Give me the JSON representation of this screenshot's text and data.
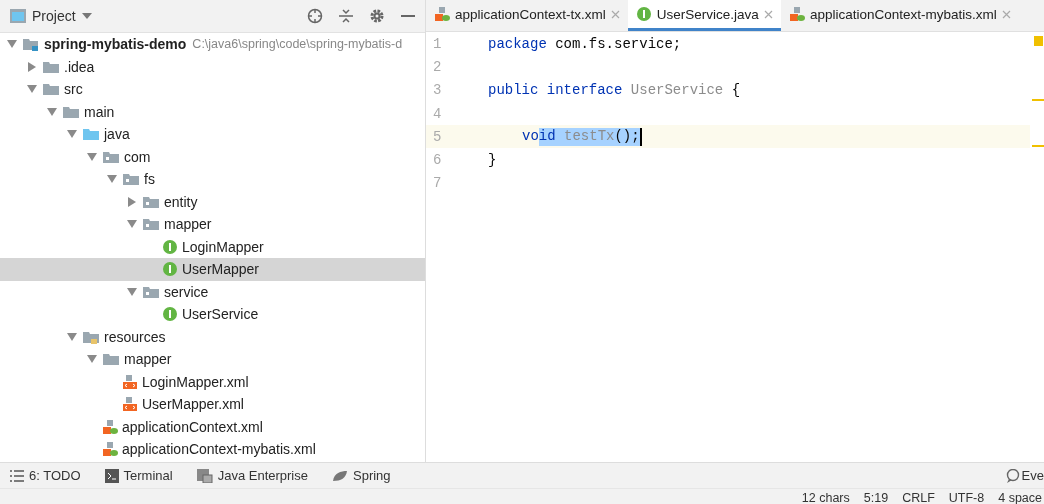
{
  "project_panel": {
    "title": "Project",
    "tree": [
      {
        "name": "spring-mybatis-demo",
        "path": "C:\\java6\\spring\\code\\spring-mybatis-d",
        "kind": "module",
        "expanded": true,
        "selected": false,
        "children": [
          {
            "name": ".idea",
            "kind": "folder",
            "expanded": false,
            "selected": false
          },
          {
            "name": "src",
            "kind": "folder",
            "expanded": true,
            "selected": false,
            "children": [
              {
                "name": "main",
                "kind": "folder",
                "expanded": true,
                "selected": false,
                "children": [
                  {
                    "name": "java",
                    "kind": "source-folder",
                    "expanded": true,
                    "selected": false,
                    "children": [
                      {
                        "name": "com",
                        "kind": "package",
                        "expanded": true,
                        "selected": false,
                        "children": [
                          {
                            "name": "fs",
                            "kind": "package",
                            "expanded": true,
                            "selected": false,
                            "children": [
                              {
                                "name": "entity",
                                "kind": "package",
                                "expanded": false,
                                "selected": false
                              },
                              {
                                "name": "mapper",
                                "kind": "package",
                                "expanded": true,
                                "selected": false,
                                "children": [
                                  {
                                    "name": "LoginMapper",
                                    "kind": "interface",
                                    "selected": false
                                  },
                                  {
                                    "name": "UserMapper",
                                    "kind": "interface",
                                    "selected": true
                                  }
                                ]
                              },
                              {
                                "name": "service",
                                "kind": "package",
                                "expanded": true,
                                "selected": false,
                                "children": [
                                  {
                                    "name": "UserService",
                                    "kind": "interface",
                                    "selected": false
                                  }
                                ]
                              }
                            ]
                          }
                        ]
                      }
                    ]
                  },
                  {
                    "name": "resources",
                    "kind": "resources-folder",
                    "expanded": true,
                    "selected": false,
                    "children": [
                      {
                        "name": "mapper",
                        "kind": "folder",
                        "expanded": true,
                        "selected": false,
                        "children": [
                          {
                            "name": "LoginMapper.xml",
                            "kind": "xml",
                            "selected": false
                          },
                          {
                            "name": "UserMapper.xml",
                            "kind": "xml",
                            "selected": false
                          }
                        ]
                      },
                      {
                        "name": "applicationContext.xml",
                        "kind": "spring-xml",
                        "selected": false
                      },
                      {
                        "name": "applicationContext-mybatis.xml",
                        "kind": "spring-xml",
                        "selected": false
                      }
                    ]
                  }
                ]
              }
            ]
          }
        ]
      }
    ]
  },
  "editor": {
    "tabs": [
      {
        "label": "applicationContext-tx.xml",
        "kind": "spring-xml",
        "selected": false
      },
      {
        "label": "UserService.java",
        "kind": "interface",
        "selected": true
      },
      {
        "label": "applicationContext-mybatis.xml",
        "kind": "spring-xml",
        "selected": false
      }
    ],
    "lines": [
      {
        "number": "1",
        "current": false,
        "tokens": [
          {
            "text": "package",
            "kind": "keyword",
            "selected": false
          },
          {
            "text": " com.fs.service;",
            "kind": "plain",
            "selected": false
          }
        ]
      },
      {
        "number": "2",
        "current": false
      },
      {
        "number": "3",
        "current": false,
        "tokens": [
          {
            "text": "public interface",
            "kind": "keyword",
            "selected": false
          },
          {
            "text": " UserService",
            "kind": "unused",
            "selected": false
          },
          {
            "text": " {",
            "kind": "plain",
            "selected": false
          }
        ]
      },
      {
        "number": "4",
        "current": false
      },
      {
        "number": "5",
        "current": true,
        "indented": true,
        "tokens": [
          {
            "text": "vo",
            "kind": "keyword",
            "selected": false
          },
          {
            "text": "id",
            "kind": "keyword",
            "selected": true
          },
          {
            "text": " testTx",
            "kind": "unused",
            "selected": true
          },
          {
            "text": "();",
            "kind": "plain",
            "selected": true
          }
        ]
      },
      {
        "number": "6",
        "current": false,
        "tokens": [
          {
            "text": "}",
            "kind": "plain",
            "selected": false
          }
        ]
      },
      {
        "number": "7",
        "current": false
      }
    ]
  },
  "tool_windows": [
    {
      "label": "6: TODO",
      "kind": "todo"
    },
    {
      "label": "Terminal",
      "kind": "terminal"
    },
    {
      "label": "Java Enterprise",
      "kind": "enterprise"
    },
    {
      "label": "Spring",
      "kind": "spring"
    }
  ],
  "event_log": {
    "label": "Eve"
  },
  "status_bar": [
    "12 chars",
    "5:19",
    "CRLF",
    "UTF-8",
    "4 space"
  ]
}
